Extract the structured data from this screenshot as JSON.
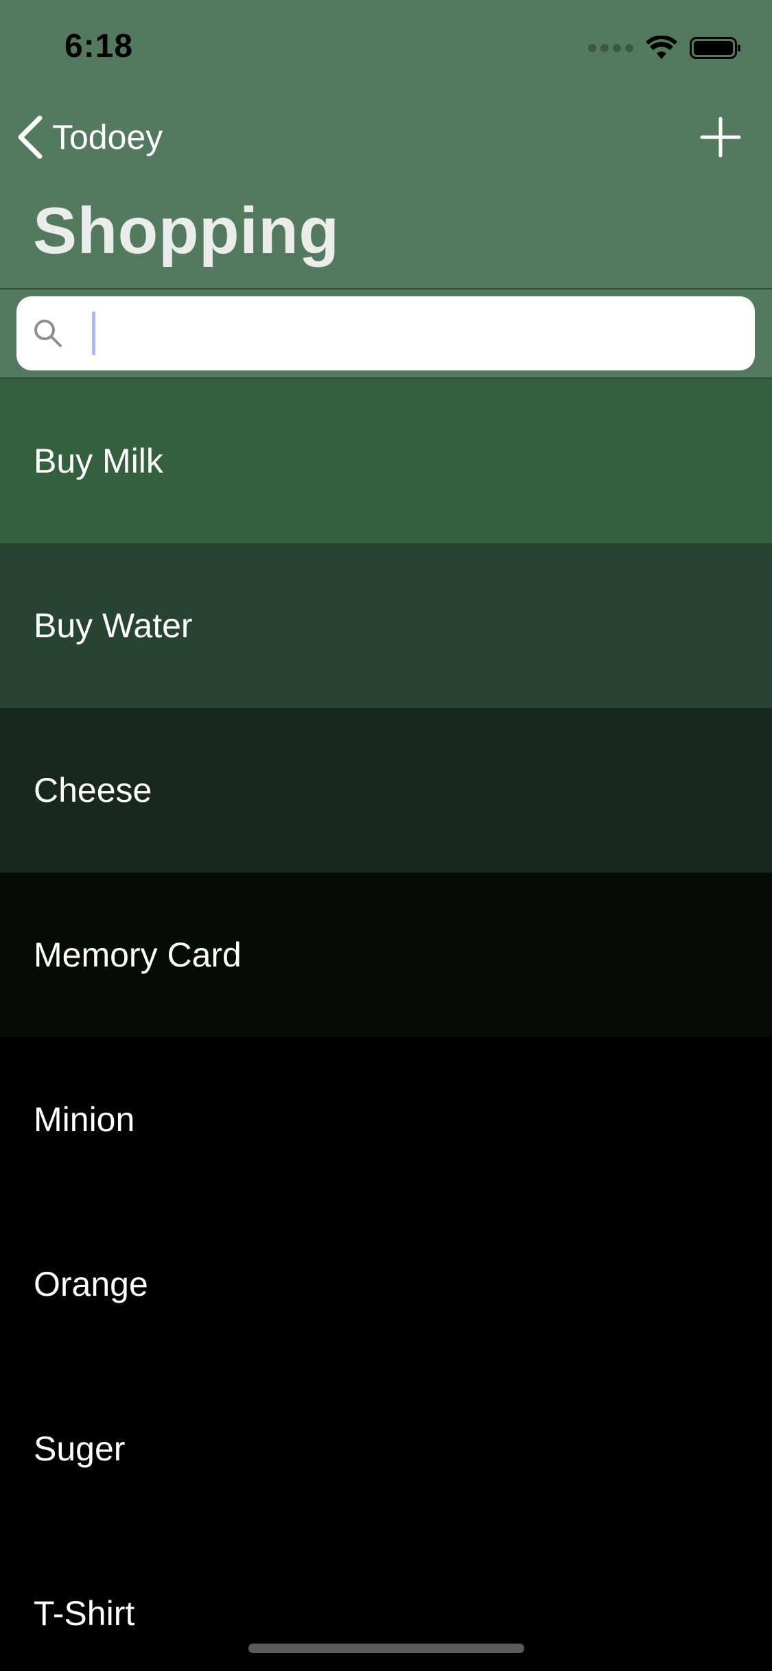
{
  "status_bar": {
    "time": "6:18"
  },
  "nav": {
    "back_label": "Todoey",
    "title": "Shopping"
  },
  "search": {
    "value": "",
    "placeholder": ""
  },
  "colors": {
    "header_bg": "#537A5F",
    "title_text": "#EAEDEA"
  },
  "items": [
    {
      "label": "Buy Milk",
      "bg": "#35603F"
    },
    {
      "label": "Buy Water",
      "bg": "#264431"
    },
    {
      "label": "Cheese",
      "bg": "#19281E"
    },
    {
      "label": "Memory Card",
      "bg": "#070B08"
    },
    {
      "label": "Minion",
      "bg": "#000000"
    },
    {
      "label": "Orange",
      "bg": "#000000"
    },
    {
      "label": "Suger",
      "bg": "#000000"
    },
    {
      "label": "T-Shirt",
      "bg": "#000000"
    }
  ]
}
